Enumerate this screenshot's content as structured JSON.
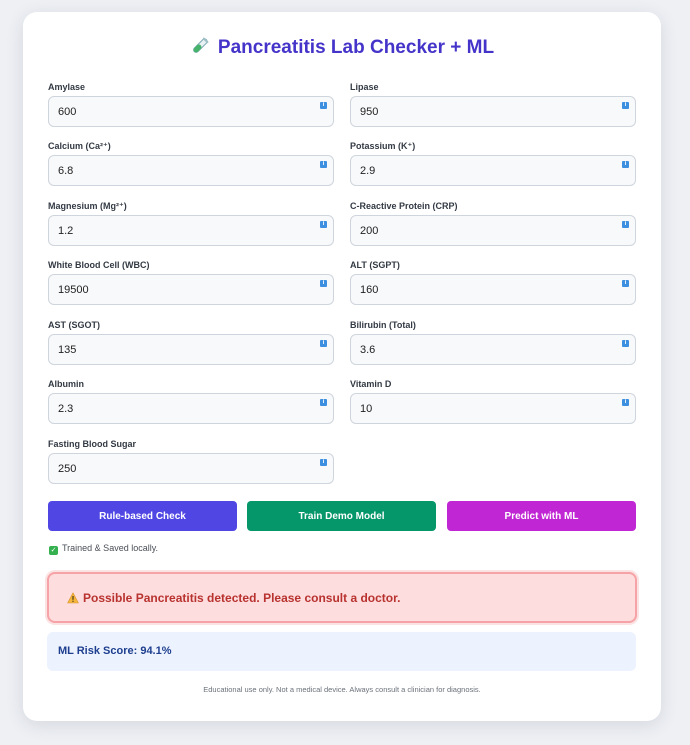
{
  "app": {
    "title": "Pancreatitis Lab Checker + ML",
    "title_icon": "test-tube-icon"
  },
  "fields": [
    {
      "label": "Amylase",
      "value": "600"
    },
    {
      "label": "Lipase",
      "value": "950"
    },
    {
      "label": "Calcium (Ca²⁺)",
      "value": "6.8"
    },
    {
      "label": "Potassium (K⁺)",
      "value": "2.9"
    },
    {
      "label": "Magnesium (Mg²⁺)",
      "value": "1.2"
    },
    {
      "label": "C-Reactive Protein (CRP)",
      "value": "200"
    },
    {
      "label": "White Blood Cell (WBC)",
      "value": "19500"
    },
    {
      "label": "ALT (SGPT)",
      "value": "160"
    },
    {
      "label": "AST (SGOT)",
      "value": "135"
    },
    {
      "label": "Bilirubin (Total)",
      "value": "3.6"
    },
    {
      "label": "Albumin",
      "value": "2.3"
    },
    {
      "label": "Vitamin D",
      "value": "10"
    },
    {
      "label": "Fasting Blood Sugar",
      "value": "250"
    }
  ],
  "field_icon": "info-icon",
  "buttons": {
    "rule_check": "Rule-based Check",
    "train": "Train Demo Model",
    "predict": "Predict with ML"
  },
  "colors": {
    "title": "#4534c9",
    "rule_check": "#5046e4",
    "train": "#059669",
    "predict": "#c026d3",
    "alert_bg": "#fdddde",
    "alert_text": "#b8322f",
    "score_bg": "#ecf3fe",
    "score_text": "#1e3e8f"
  },
  "status": {
    "icon": "check-mark-icon",
    "text": "Trained & Saved locally."
  },
  "alert": {
    "icon": "warning-icon",
    "text": "Possible Pancreatitis detected. Please consult a doctor."
  },
  "ml_score": {
    "text": "ML Risk Score: 94.1%"
  },
  "footer": "Educational use only. Not a medical device. Always consult a clinician for diagnosis."
}
